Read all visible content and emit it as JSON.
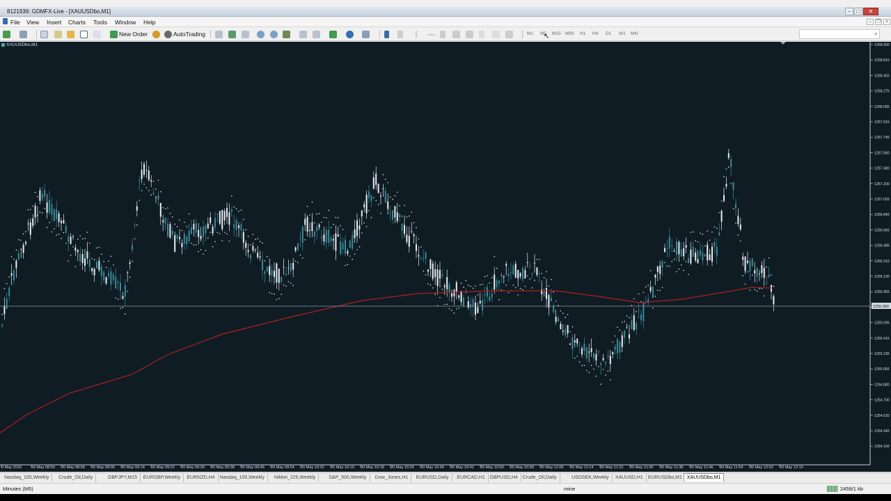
{
  "window": {
    "title": "8121939: GDMFX-Live - [XAUUSDbo,M1]"
  },
  "menu": [
    "File",
    "View",
    "Insert",
    "Charts",
    "Tools",
    "Window",
    "Help"
  ],
  "toolbar": {
    "new_order_label": "New Order",
    "autotrading_label": "AutoTrading",
    "timeframes": [
      "M1",
      "M5",
      "M15",
      "M30",
      "H1",
      "H4",
      "D1",
      "W1",
      "MN"
    ]
  },
  "chart": {
    "label": "XAUUSDbo,M1",
    "current_price_label": "1255.960",
    "price_axis": [
      "1258.990",
      "1258.810",
      "1258.455",
      "1258.275",
      "1258.095",
      "1257.915",
      "1257.740",
      "1257.560",
      "1257.380",
      "1257.200",
      "1257.020",
      "1256.840",
      "1256.665",
      "1256.485",
      "1256.310",
      "1256.130",
      "1255.955",
      "1255.775",
      "1255.595",
      "1255.415",
      "1255.235",
      "1255.055",
      "1254.880",
      "1254.700",
      "1254.520",
      "1254.340",
      "1254.160"
    ],
    "time_axis": [
      "0 May 2016",
      "20 May 08:50",
      "20 May 08:58",
      "20 May 09:06",
      "20 May 09:14",
      "20 May 09:22",
      "20 May 09:30",
      "20 May 09:38",
      "20 May 09:46",
      "20 May 09:54",
      "20 May 10:02",
      "20 May 10:10",
      "20 May 10:18",
      "20 May 10:26",
      "20 May 10:34",
      "20 May 10:42",
      "20 May 10:50",
      "20 May 10:58",
      "20 May 11:06",
      "20 May 11:14",
      "20 May 11:22",
      "20 May 11:30",
      "20 May 11:38",
      "20 May 11:46",
      "20 May 11:54",
      "20 May 12:02",
      "20 May 12:10"
    ]
  },
  "tabs": [
    "Nasdaq_100,Weekly",
    "Crude_Oil,Daily",
    "GBPJPY,M15",
    "EURGBP,Weekly",
    "EURNZD,H4",
    "Nasdaq_100,Weekly",
    "Nikkei_225,Weekly",
    "S&P_500,Weekly",
    "Dow_Jones,H1",
    "EURUSD,Daily",
    "EURCAD,H1",
    "GBPUSD,H4",
    "Crude_Oil,Daily",
    "USDSEK,Weekly",
    "XAUUSD,H1",
    "EURUSDbo,M1",
    "XAUUSDbo,M1"
  ],
  "active_tab": "XAUUSDbo,M1",
  "status": {
    "left": "Minutes (M5)",
    "profile": "mine",
    "traffic": "2459/1 kb"
  },
  "colors": {
    "chart_bg": "#0f1c24",
    "candle": "#4a90a0",
    "ma": "#b01e1e",
    "psar": "#ffffff"
  }
}
